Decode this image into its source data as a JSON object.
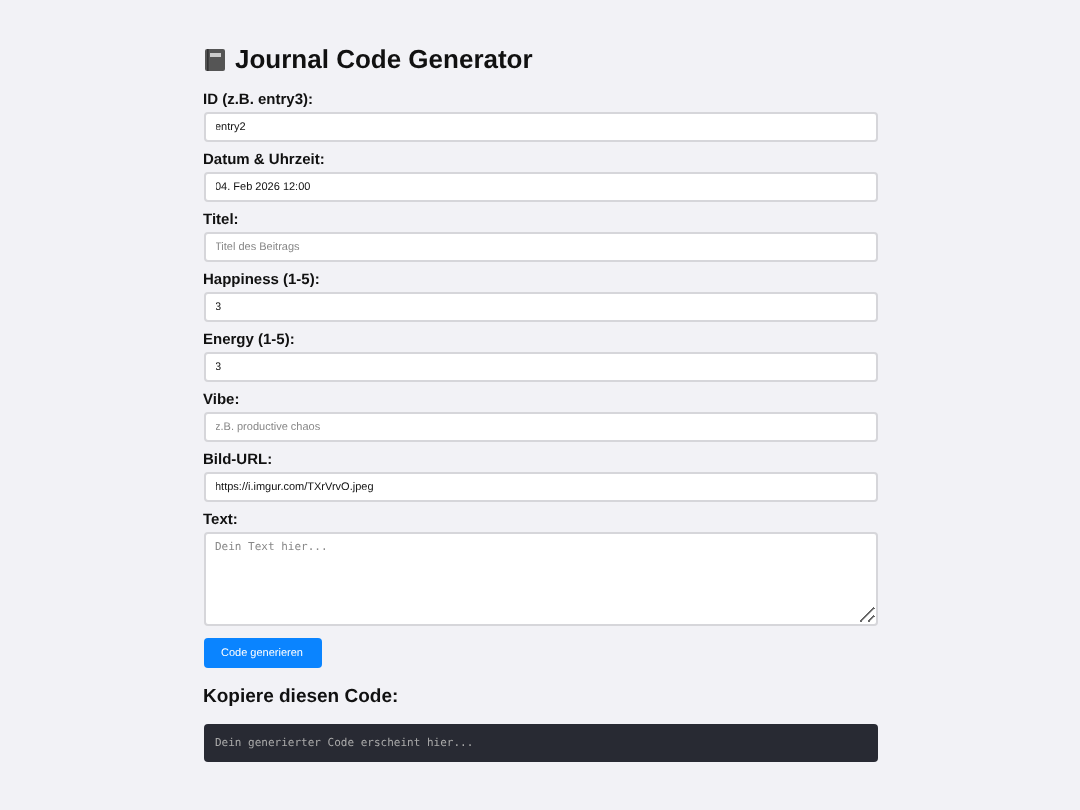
{
  "title": "Journal Code Generator",
  "fields": [
    {
      "label": "ID (z.B. entry3):",
      "kind": "input",
      "value": "entry2"
    },
    {
      "label": "Datum & Uhrzeit:",
      "kind": "input",
      "value": "04. Feb 2026 12:00"
    },
    {
      "label": "Titel:",
      "kind": "input",
      "placeholder": "Titel des Beitrags"
    },
    {
      "label": "Happiness (1-5):",
      "kind": "input",
      "value": "3"
    },
    {
      "label": "Energy (1-5):",
      "kind": "input",
      "value": "3"
    },
    {
      "label": "Vibe:",
      "kind": "input",
      "placeholder": "z.B. productive chaos"
    },
    {
      "label": "Bild-URL:",
      "kind": "input",
      "value": "https://i.imgur.com/TXrVrvO.jpeg"
    },
    {
      "label": "Text:",
      "kind": "textarea",
      "placeholder": "Dein Text hier..."
    }
  ],
  "button": "Code generieren",
  "output_heading": "Kopiere diesen Code:",
  "code_output": "Dein generierter Code erscheint hier..."
}
